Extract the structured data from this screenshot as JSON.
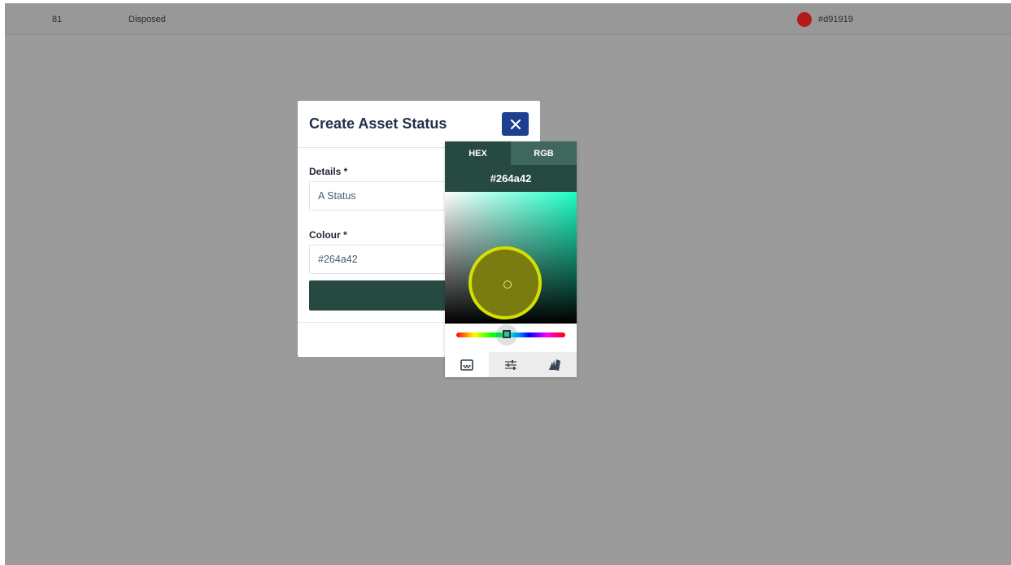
{
  "colors": {
    "accent_dark_green": "#264a42",
    "close_blue": "#1d3f8f",
    "disposed_red": "#d91919",
    "picker_tab_inactive": "#3f675d",
    "mode_inactive": "#ececec"
  },
  "background_row": {
    "id": "81",
    "status": "Disposed",
    "hex": "#d91919"
  },
  "dialog": {
    "title": "Create Asset Status",
    "close_icon": "close-icon",
    "details_label": "Details *",
    "details_value": "A Status",
    "colour_label": "Colour *",
    "colour_value": "#264a42"
  },
  "color_picker": {
    "tabs": [
      "HEX",
      "RGB"
    ],
    "active_tab": "HEX",
    "hex_value": "#264a42",
    "modes": [
      "gradient-palette-icon",
      "sliders-icon",
      "swatches-icon"
    ],
    "active_mode": "gradient-palette-icon"
  }
}
